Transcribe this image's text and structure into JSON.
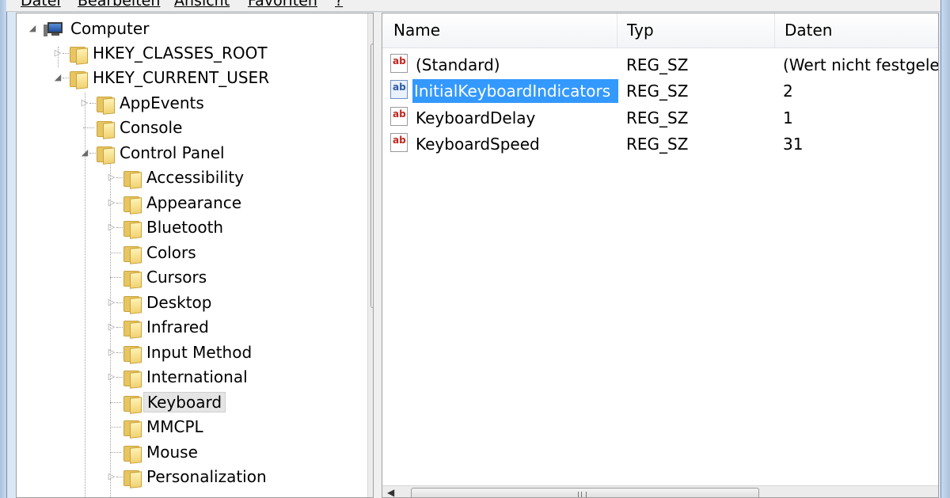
{
  "menu": [
    "Datei",
    "Bearbeiten",
    "Ansicht",
    "Favoriten",
    "?"
  ],
  "tree": {
    "items": [
      {
        "label": "Computer",
        "expander": "expanded",
        "icon": "computer-icon",
        "selected": false
      },
      {
        "label": "HKEY_CLASSES_ROOT",
        "expander": "collapsed",
        "icon": "folder-icon",
        "selected": false
      },
      {
        "label": "HKEY_CURRENT_USER",
        "expander": "expanded",
        "icon": "folder-icon",
        "selected": false
      },
      {
        "label": "AppEvents",
        "expander": "collapsed",
        "icon": "folder-icon",
        "selected": false
      },
      {
        "label": "Console",
        "expander": "none",
        "icon": "folder-icon",
        "selected": false
      },
      {
        "label": "Control Panel",
        "expander": "expanded",
        "icon": "folder-icon",
        "selected": false
      },
      {
        "label": "Accessibility",
        "expander": "collapsed",
        "icon": "folder-icon",
        "selected": false
      },
      {
        "label": "Appearance",
        "expander": "collapsed",
        "icon": "folder-icon",
        "selected": false
      },
      {
        "label": "Bluetooth",
        "expander": "collapsed",
        "icon": "folder-icon",
        "selected": false
      },
      {
        "label": "Colors",
        "expander": "none",
        "icon": "folder-icon",
        "selected": false
      },
      {
        "label": "Cursors",
        "expander": "none",
        "icon": "folder-icon",
        "selected": false
      },
      {
        "label": "Desktop",
        "expander": "collapsed",
        "icon": "folder-icon",
        "selected": false
      },
      {
        "label": "Infrared",
        "expander": "collapsed",
        "icon": "folder-icon",
        "selected": false
      },
      {
        "label": "Input Method",
        "expander": "collapsed",
        "icon": "folder-icon",
        "selected": false
      },
      {
        "label": "International",
        "expander": "collapsed",
        "icon": "folder-icon",
        "selected": false
      },
      {
        "label": "Keyboard",
        "expander": "none",
        "icon": "folder-icon",
        "selected": true
      },
      {
        "label": "MMCPL",
        "expander": "none",
        "icon": "folder-icon",
        "selected": false
      },
      {
        "label": "Mouse",
        "expander": "none",
        "icon": "folder-icon",
        "selected": false
      },
      {
        "label": "Personalization",
        "expander": "collapsed",
        "icon": "folder-icon",
        "selected": false
      }
    ]
  },
  "list": {
    "columns": [
      "Name",
      "Typ",
      "Daten"
    ],
    "rows": [
      {
        "name": "(Standard)",
        "type": "REG_SZ",
        "data": "(Wert nicht festgeleg",
        "selected": false
      },
      {
        "name": "InitialKeyboardIndicators",
        "type": "REG_SZ",
        "data": "2",
        "selected": true
      },
      {
        "name": "KeyboardDelay",
        "type": "REG_SZ",
        "data": "1",
        "selected": false
      },
      {
        "name": "KeyboardSpeed",
        "type": "REG_SZ",
        "data": "31",
        "selected": false
      }
    ],
    "value_icon": "reg-string-icon"
  },
  "colors": {
    "selection": "#3399ff",
    "tree_selection": "#e5e5e5",
    "frame": "#a9c1dc"
  }
}
